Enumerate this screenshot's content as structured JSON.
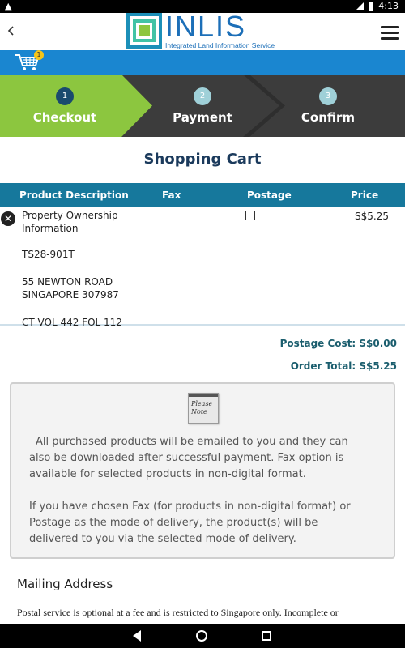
{
  "status_bar": {
    "time": "4:13",
    "warning": "▲"
  },
  "header": {
    "logo_name": "INLIS",
    "logo_tagline": "Integrated Land Information Service",
    "back_icon": "chevron-left-icon",
    "menu_icon": "hamburger-menu-icon"
  },
  "cart": {
    "badge_count": "1"
  },
  "steps": [
    {
      "number": "1",
      "label": "Checkout",
      "active": true
    },
    {
      "number": "2",
      "label": "Payment",
      "active": false
    },
    {
      "number": "3",
      "label": "Confirm",
      "active": false
    }
  ],
  "page_title": "Shopping Cart",
  "table": {
    "headers": [
      "Product Description",
      "Fax",
      "Postage",
      "Price"
    ],
    "rows": [
      {
        "name": "Property Ownership Information",
        "ref": "TS28-901T",
        "address": "55 NEWTON ROAD SINGAPORE 307987",
        "ct_vol": "CT VOL 442 FOL 112",
        "postage_checked": false,
        "price": "S$5.25"
      }
    ]
  },
  "totals": {
    "postage_cost": "Postage Cost: S$0.00",
    "order_total": "Order Total: S$5.25"
  },
  "notice": {
    "icon_text": "Please Note",
    "paragraph1": "All purchased products will be emailed to you and they can also be downloaded after successful payment. Fax option is available for selected products in non-digital format.",
    "paragraph2": "If you have chosen Fax (for products in non-digital format) or Postage as the mode of delivery, the product(s) will be delivered to you via the selected mode of delivery."
  },
  "mailing": {
    "title": "Mailing Address",
    "text": "Postal service is optional at a fee and is restricted to Singapore only. Incomplete or"
  },
  "colors": {
    "cart_bar": "#1a86d0",
    "step_active": "#8cc63f",
    "step_bg": "#3c3c3c",
    "table_header": "#16789c",
    "title": "#1b3a5c",
    "totals_text": "#1b5e6e"
  }
}
